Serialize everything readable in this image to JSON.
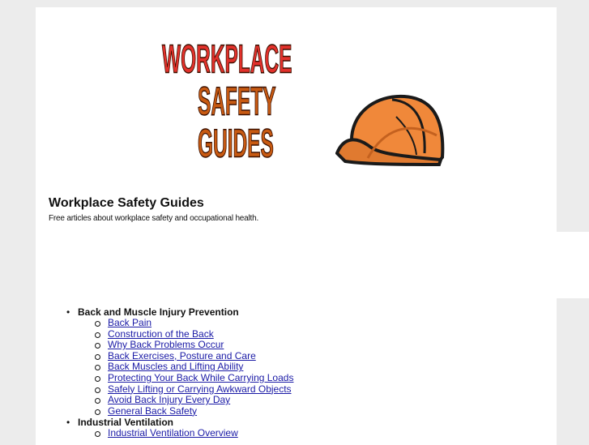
{
  "logo": {
    "line1": "WORKPLACE",
    "line2": "SAFETY",
    "line3": "GUIDES",
    "icon": "hardhat-icon",
    "colors": {
      "red": "#e2312b",
      "orange": "#c85a12",
      "hat": "#f0883a"
    }
  },
  "site": {
    "title": "Workplace Safety Guides",
    "tagline": "Free articles about workplace safety and occupational health."
  },
  "categories": [
    {
      "label": "Back and Muscle Injury Prevention",
      "links": [
        "Back Pain",
        "Construction of the Back",
        "Why Back Problems Occur",
        "Back Exercises, Posture and Care",
        "Back Muscles and Lifting Ability",
        "Protecting Your Back While Carrying Loads",
        "Safely Lifting or Carrying Awkward Objects",
        "Avoid Back Injury Every Day",
        "General Back Safety"
      ]
    },
    {
      "label": "Industrial Ventilation",
      "links": [
        "Industrial Ventilation Overview"
      ]
    }
  ]
}
